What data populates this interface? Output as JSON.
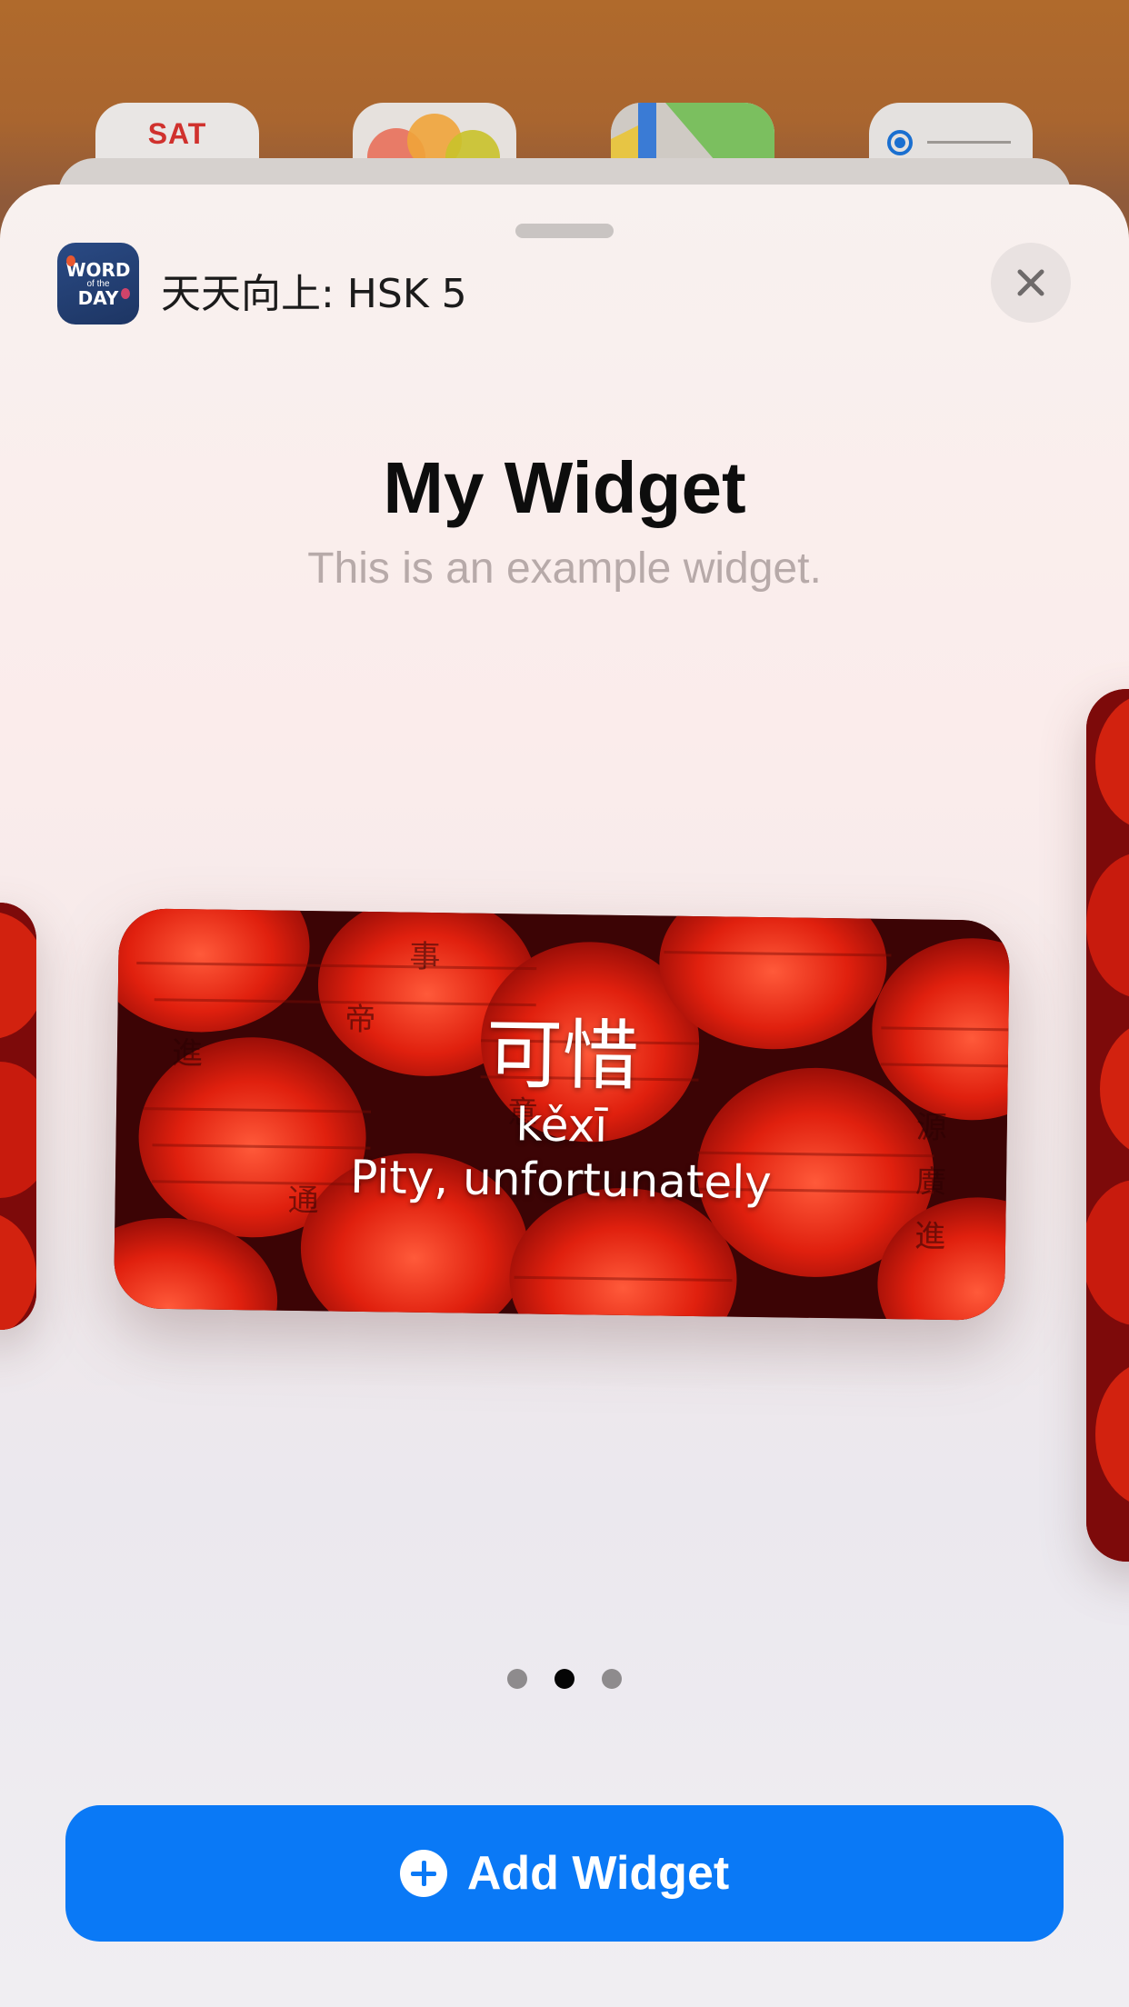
{
  "background": {
    "calendar_day": "SAT"
  },
  "sheet": {
    "app_icon": {
      "line1": "WORD",
      "line2": "of the",
      "line3": "DAY"
    },
    "app_name": "天天向上: HSK 5",
    "close_icon": "close-icon",
    "widget_title": "My Widget",
    "widget_description": "This is an example widget."
  },
  "widget": {
    "hanzi": "可惜",
    "pinyin": "kěxī",
    "meaning": "Pity, unfortunately",
    "background_color": "#c9180f"
  },
  "pager": {
    "page_count": 3,
    "active_index": 1
  },
  "actions": {
    "add_widget_label": "Add Widget",
    "add_widget_icon": "plus-circle-icon",
    "accent_color": "#0a79f6"
  }
}
